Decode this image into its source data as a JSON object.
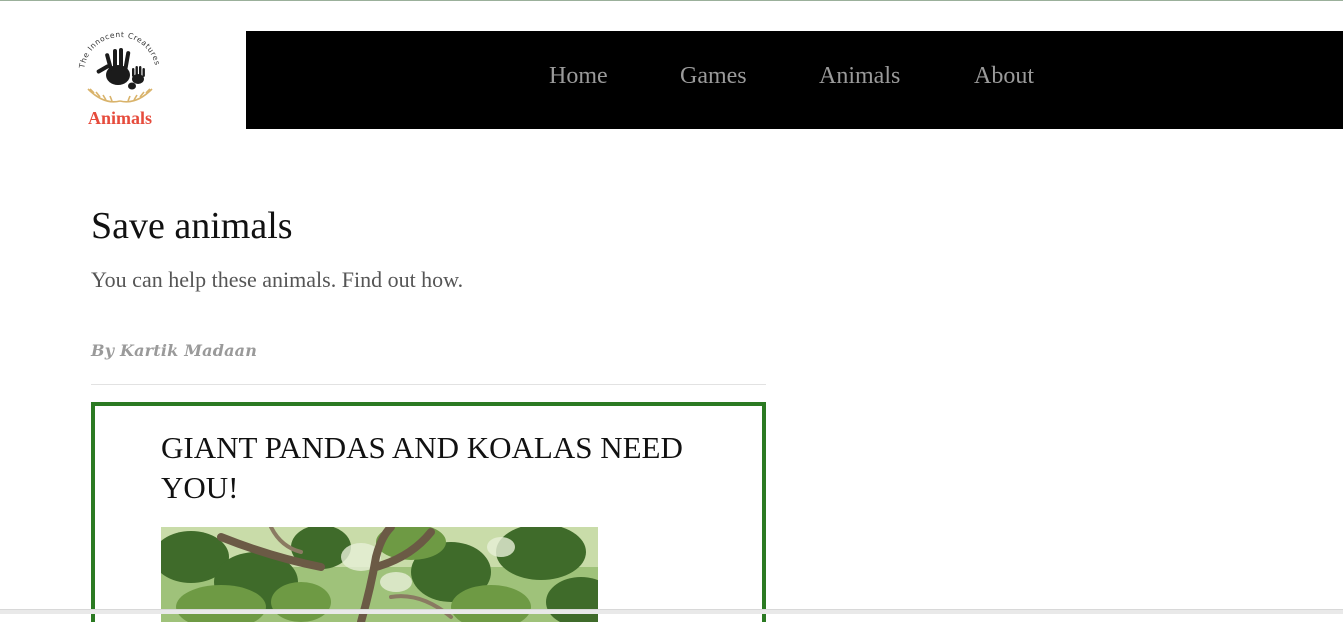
{
  "logo": {
    "text": "Animals",
    "circle_text": "The Innocent Creatures",
    "icon": "handprint-logo-icon"
  },
  "nav": {
    "items": [
      {
        "label": "Home"
      },
      {
        "label": "Games"
      },
      {
        "label": "Animals"
      },
      {
        "label": "About"
      }
    ]
  },
  "page": {
    "title": "Save animals",
    "subtitle": "You can help these animals. Find out how.",
    "byline": "By Kartik Madaan"
  },
  "card": {
    "title": "GIANT PANDAS AND KOALAS NEED YOU!",
    "image": "tree-foliage-photo"
  },
  "colors": {
    "nav_background": "#000000",
    "nav_text": "#9a9a9a",
    "logo_text": "#e64b3c",
    "card_border": "#2b7a22"
  }
}
